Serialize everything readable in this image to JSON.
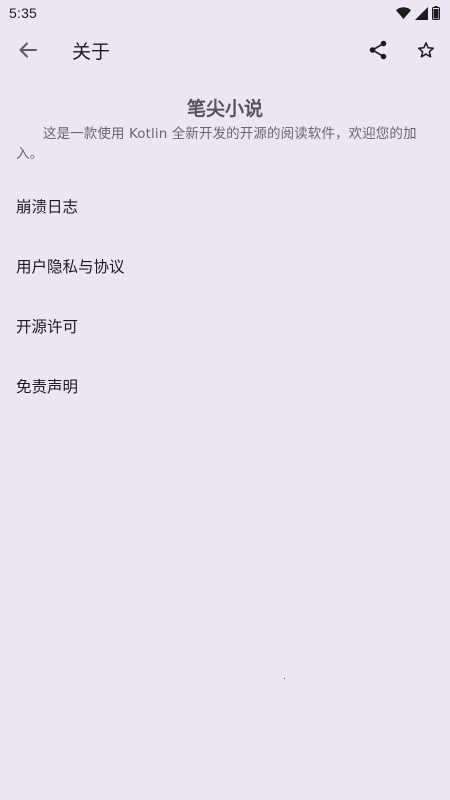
{
  "status_bar": {
    "time": "5:35",
    "icons": [
      "wifi-icon",
      "signal-icon",
      "battery-icon"
    ]
  },
  "app_bar": {
    "title": "关于",
    "back_icon": "arrow-back-icon",
    "share_icon": "share-icon",
    "star_icon": "star-outline-icon"
  },
  "about": {
    "app_name": "笔尖小说",
    "description": "这是一款使用 Kotlin 全新开发的开源的阅读软件，欢迎您的加入。"
  },
  "menu": {
    "items": [
      {
        "label": "崩溃日志"
      },
      {
        "label": "用户隐私与协议"
      },
      {
        "label": "开源许可"
      },
      {
        "label": "免责声明"
      }
    ]
  },
  "colors": {
    "background": "#ece6f2",
    "text_primary": "#1c1b1f",
    "text_secondary": "#6a6670"
  }
}
